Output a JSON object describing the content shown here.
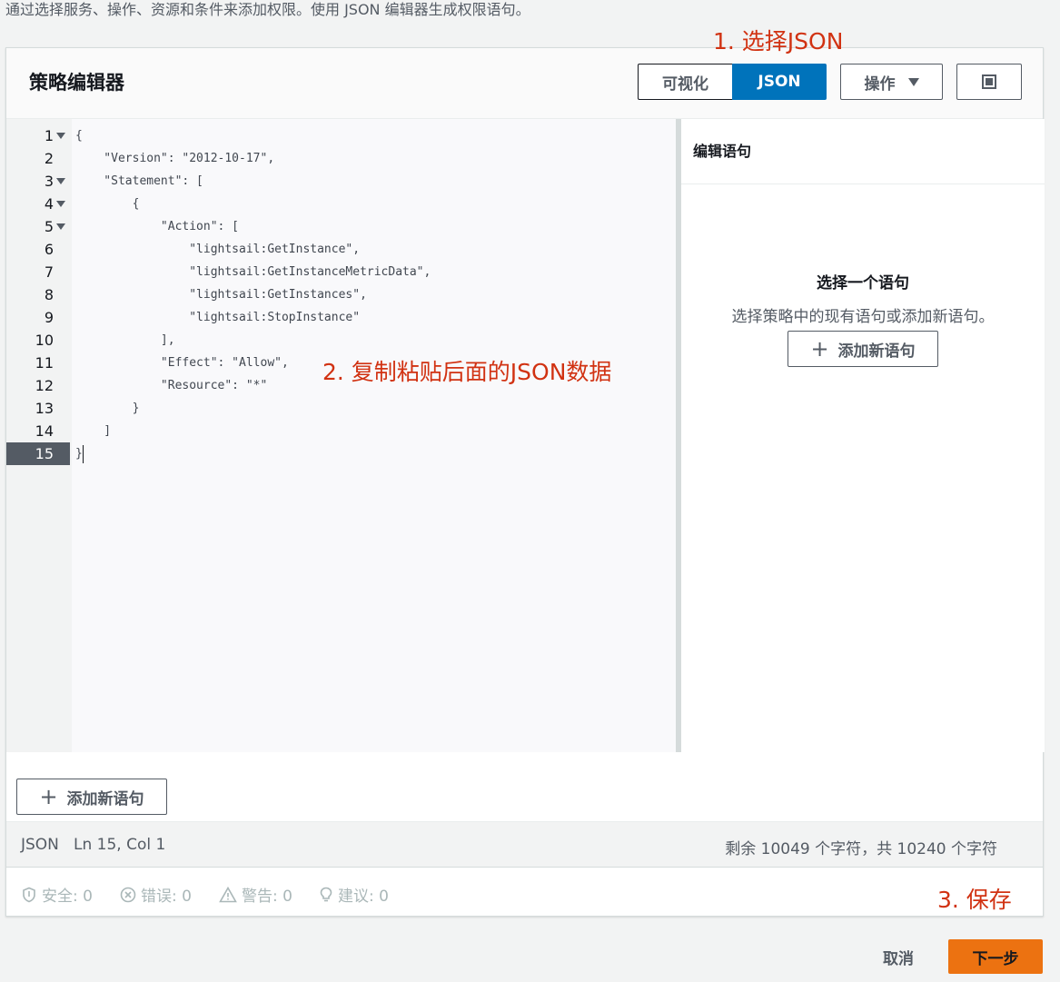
{
  "intro_text": "通过选择服务、操作、资源和条件来添加权限。使用 JSON 编辑器生成权限语句。",
  "annotations": {
    "step1": "1. 选择JSON",
    "step2": "2. 复制粘贴后面的JSON数据",
    "step3": "3. 保存"
  },
  "header": {
    "title": "策略编辑器",
    "mode_visual": "可视化",
    "mode_json": "JSON",
    "actions_label": "操作"
  },
  "editor": {
    "lines": [
      {
        "num": "1",
        "fold": true,
        "text": "{"
      },
      {
        "num": "2",
        "fold": false,
        "text": "    \"Version\": \"2012-10-17\","
      },
      {
        "num": "3",
        "fold": true,
        "text": "    \"Statement\": ["
      },
      {
        "num": "4",
        "fold": true,
        "text": "        {"
      },
      {
        "num": "5",
        "fold": true,
        "text": "            \"Action\": ["
      },
      {
        "num": "6",
        "fold": false,
        "text": "                \"lightsail:GetInstance\","
      },
      {
        "num": "7",
        "fold": false,
        "text": "                \"lightsail:GetInstanceMetricData\","
      },
      {
        "num": "8",
        "fold": false,
        "text": "                \"lightsail:GetInstances\","
      },
      {
        "num": "9",
        "fold": false,
        "text": "                \"lightsail:StopInstance\""
      },
      {
        "num": "10",
        "fold": false,
        "text": "            ],"
      },
      {
        "num": "11",
        "fold": false,
        "text": "            \"Effect\": \"Allow\","
      },
      {
        "num": "12",
        "fold": false,
        "text": "            \"Resource\": \"*\""
      },
      {
        "num": "13",
        "fold": false,
        "text": "        }"
      },
      {
        "num": "14",
        "fold": false,
        "text": "    ]"
      },
      {
        "num": "15",
        "fold": false,
        "text": "}"
      }
    ],
    "active_line": "15",
    "add_statement_label": "添加新语句"
  },
  "right_panel": {
    "title": "编辑语句",
    "empty_title": "选择一个语句",
    "empty_desc": "选择策略中的现有语句或添加新语句。",
    "add_statement_label": "添加新语句"
  },
  "status_bar": {
    "mode": "JSON",
    "position": "Ln 15, Col 1",
    "chars": "剩余 10049 个字符，共 10240 个字符"
  },
  "checks": {
    "security": "安全: 0",
    "errors": "错误: 0",
    "warnings": "警告: 0",
    "suggestions": "建议: 0"
  },
  "footer": {
    "cancel": "取消",
    "next": "下一步"
  },
  "colors": {
    "primary": "#0073bb",
    "next_button": "#ec7211",
    "annotation": "#d13212"
  }
}
